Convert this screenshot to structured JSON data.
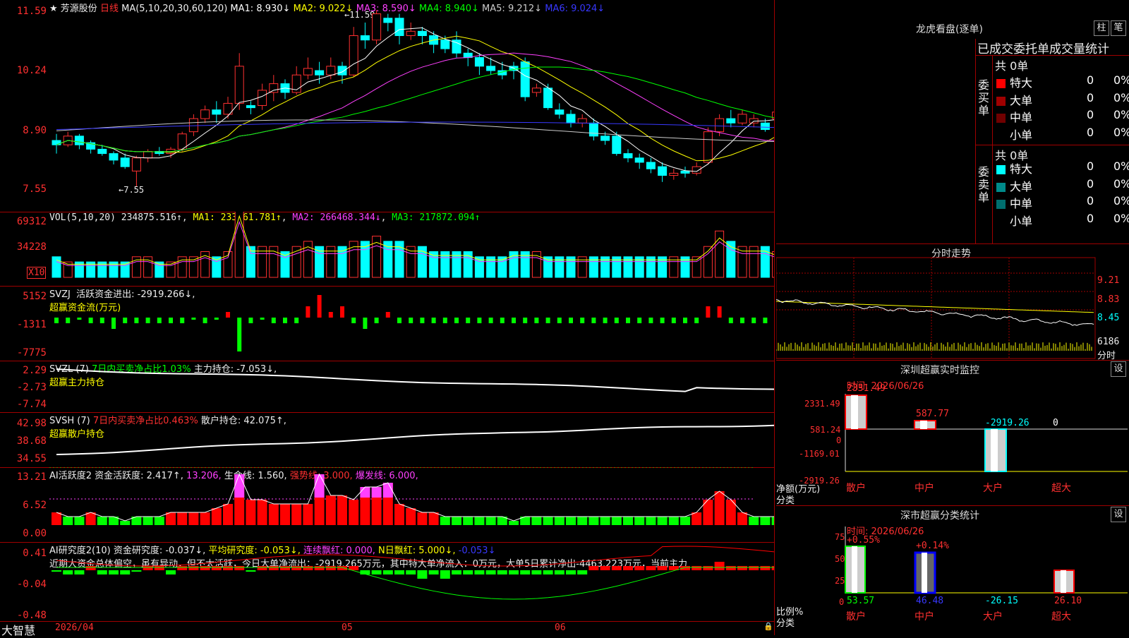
{
  "main": {
    "stock_name": "芳源股份",
    "period": "日线",
    "ma_params": "MA(5,10,20,30,60,120)",
    "ma": [
      {
        "label": "MA1: 8.930↓",
        "color": "#ffffff"
      },
      {
        "label": "MA2: 9.022↓",
        "color": "#ffff00"
      },
      {
        "label": "MA3: 8.590↓",
        "color": "#ff40ff"
      },
      {
        "label": "MA4: 8.940↓",
        "color": "#00ff00"
      },
      {
        "label": "MA5: 9.212↓",
        "color": "#cccccc"
      },
      {
        "label": "MA6: 9.024↓",
        "color": "#3838ff"
      }
    ],
    "y_ticks": [
      "11.59",
      "10.24",
      "8.90",
      "7.55"
    ],
    "high_label": "11.59",
    "low_label": "7.55"
  },
  "vol": {
    "title": "VOL(5,10,20)",
    "value": "234875.516↑",
    "ma1": "MA1: 233261.781↑",
    "ma2": "MA2: 266468.344↓",
    "ma3": "MA3: 217872.094↑",
    "y_ticks": [
      "69312",
      "34228"
    ],
    "unit": "X10"
  },
  "svzj": {
    "title": "SVZJ",
    "label": "活跃资金进出: -2919.266↓,",
    "subtitle": "超赢资金流(万元)",
    "y_ticks": [
      "5152",
      "-1311",
      "-7775"
    ]
  },
  "svzl": {
    "title": "SVZL (7)",
    "ratio": "7日内买卖净占比1.03%",
    "label": "主力持仓: -7.053↓,",
    "subtitle": "超赢主力持仓",
    "y_ticks": [
      "2.29",
      "-2.73",
      "-7.74"
    ]
  },
  "svsh": {
    "title": "SVSH (7)",
    "ratio": "7日内买卖净占比0.463%",
    "label": "散户持仓: 42.075↑,",
    "subtitle": "超赢散户持仓",
    "y_ticks": [
      "42.98",
      "38.68",
      "34.55"
    ]
  },
  "ai1": {
    "title": "AI活跃度2",
    "label1": "资金活跃度: 2.417↑,",
    "label2": "13.206,",
    "label3": "生命线: 1.560,",
    "label4": "强势线: 3.000,",
    "label5": "爆发线: 6.000,",
    "y_ticks": [
      "13.21",
      "6.52",
      "0.00"
    ]
  },
  "ai2": {
    "title": "AI研究度2(10)",
    "label1": "资金研究度: -0.037↓,",
    "label2": "平均研究度: -0.053↓,",
    "label3": "连续飘红: 0.000,",
    "label4": "N日飘红: 5.000↓,",
    "label5": "-0.053↓",
    "comment": "近期大资金总体偏空，虽有异动，但不太活跃，今日大单净流出：-2919.265万元，其中特大单净流入：0万元，大单5日累计净出-4463.223万元，当前主力",
    "y_ticks": [
      "0.41",
      "-0.04",
      "-0.48"
    ]
  },
  "bottom": {
    "logo": "大智慧",
    "date_label": "2026/04",
    "month_05": "05",
    "month_06": "06"
  },
  "right": {
    "dragon_title": "龙虎看盘(逐单)",
    "btn_zhu": "柱",
    "btn_bi": "笔",
    "stat_header": "已成交委托单成交量统计",
    "buy_label": "委买单",
    "sell_label": "委卖单",
    "buy_total": "共 0单",
    "sell_total": "共 0单",
    "buy_rows": [
      {
        "name": "特大",
        "count": "0",
        "pct": "0%",
        "color": "#ff0000"
      },
      {
        "name": "大单",
        "count": "0",
        "pct": "0%",
        "color": "#a00000"
      },
      {
        "name": "中单",
        "count": "0",
        "pct": "0%",
        "color": "#700000"
      },
      {
        "name": "小单",
        "count": "0",
        "pct": "0%",
        "color": "#000000"
      }
    ],
    "sell_rows": [
      {
        "name": "特大",
        "count": "0",
        "pct": "0%",
        "color": "#00ffff"
      },
      {
        "name": "大单",
        "count": "0",
        "pct": "0%",
        "color": "#008b8b"
      },
      {
        "name": "中单",
        "count": "0",
        "pct": "0%",
        "color": "#006e6e"
      },
      {
        "name": "小单",
        "count": "0",
        "pct": "0%",
        "color": "#000000"
      }
    ],
    "intraday_title": "分时走势",
    "intraday_ticks": [
      "9.21",
      "8.83",
      "8.45",
      "6186"
    ],
    "intraday_unit": "分时",
    "sz_monitor_title": "深圳超赢实时监控",
    "set_btn": "设",
    "sz_time": "时间: 2026/06/26",
    "sz_ticks": [
      "2331.49",
      "581.24",
      "0",
      "-1169.01",
      "-2919.26"
    ],
    "sz_values": [
      "2331.49",
      "587.77",
      "-2919.26",
      "0"
    ],
    "sz_ylabel": "净额(万元)",
    "sz_xlabel": "分类",
    "cats": [
      "散户",
      "中户",
      "大户",
      "超大"
    ],
    "sc_title": "深市超赢分类统计",
    "sc_time": "时间: 2026/06/26",
    "sc_ticks": [
      "75",
      "50",
      "25",
      "0"
    ],
    "sc_top": [
      "+0.55%",
      "+0.14%"
    ],
    "sc_values": [
      "53.57",
      "46.48",
      "-26.15",
      "26.10"
    ],
    "sc_ylabel": "比例%",
    "sc_xlabel": "分类"
  },
  "chart_data": {
    "type": "candlestick",
    "candles": [
      [
        8.6,
        8.5,
        8.75,
        8.3
      ],
      [
        8.5,
        8.7,
        8.8,
        8.45
      ],
      [
        8.7,
        8.5,
        8.75,
        8.4
      ],
      [
        8.55,
        8.4,
        8.6,
        8.3
      ],
      [
        8.4,
        8.3,
        8.5,
        8.25
      ],
      [
        8.3,
        8.15,
        8.35,
        8.05
      ],
      [
        8.2,
        8.0,
        8.3,
        7.95
      ],
      [
        7.9,
        8.2,
        8.25,
        7.55
      ],
      [
        8.2,
        8.35,
        8.4,
        8.1
      ],
      [
        8.35,
        8.3,
        8.45,
        8.25
      ],
      [
        8.3,
        8.4,
        8.45,
        8.2
      ],
      [
        8.4,
        8.75,
        8.8,
        8.35
      ],
      [
        8.8,
        9.1,
        9.2,
        8.7
      ],
      [
        9.1,
        9.3,
        9.4,
        9.0
      ],
      [
        9.3,
        9.2,
        9.5,
        9.0
      ],
      [
        9.2,
        9.45,
        9.6,
        9.1
      ],
      [
        9.45,
        10.3,
        10.6,
        9.3
      ],
      [
        9.4,
        9.35,
        9.5,
        9.2
      ],
      [
        9.4,
        9.75,
        9.9,
        9.3
      ],
      [
        9.7,
        9.9,
        10.1,
        9.5
      ],
      [
        9.9,
        9.7,
        10.0,
        9.55
      ],
      [
        9.7,
        10.1,
        10.3,
        9.65
      ],
      [
        10.1,
        10.25,
        10.5,
        10.0
      ],
      [
        10.2,
        10.1,
        10.4,
        9.9
      ],
      [
        10.1,
        10.3,
        10.5,
        10.0
      ],
      [
        10.3,
        10.1,
        10.4,
        9.9
      ],
      [
        10.1,
        11.0,
        11.2,
        10.05
      ],
      [
        11.0,
        10.9,
        11.3,
        10.7
      ],
      [
        10.9,
        11.5,
        11.59,
        10.8
      ],
      [
        11.4,
        11.3,
        11.5,
        11.1
      ],
      [
        11.4,
        11.0,
        11.5,
        10.8
      ],
      [
        11.0,
        11.1,
        11.3,
        10.9
      ],
      [
        11.1,
        11.0,
        11.2,
        10.8
      ],
      [
        11.0,
        10.8,
        11.1,
        10.6
      ],
      [
        10.9,
        10.7,
        11.0,
        10.6
      ],
      [
        10.9,
        10.6,
        11.1,
        10.5
      ],
      [
        10.6,
        10.5,
        10.7,
        10.3
      ],
      [
        10.5,
        10.3,
        10.6,
        10.1
      ],
      [
        10.3,
        10.2,
        10.5,
        10.1
      ],
      [
        10.2,
        10.1,
        10.4,
        10.0
      ],
      [
        10.3,
        10.2,
        10.4,
        10.0
      ],
      [
        10.4,
        9.6,
        10.5,
        9.5
      ],
      [
        9.7,
        9.8,
        9.9,
        9.6
      ],
      [
        9.8,
        9.35,
        9.9,
        9.3
      ],
      [
        9.3,
        9.2,
        9.45,
        9.1
      ],
      [
        9.2,
        9.0,
        9.3,
        8.9
      ],
      [
        9.0,
        9.1,
        9.2,
        8.9
      ],
      [
        9.0,
        8.7,
        9.1,
        8.6
      ],
      [
        8.7,
        8.6,
        8.8,
        8.5
      ],
      [
        8.7,
        8.3,
        8.8,
        8.25
      ],
      [
        8.3,
        8.2,
        8.4,
        8.1
      ],
      [
        8.2,
        8.1,
        8.3,
        7.95
      ],
      [
        8.1,
        7.95,
        8.2,
        7.85
      ],
      [
        8.0,
        7.8,
        8.1,
        7.65
      ],
      [
        7.8,
        7.85,
        7.95,
        7.7
      ],
      [
        7.9,
        7.85,
        8.0,
        7.75
      ],
      [
        7.85,
        8.0,
        8.1,
        7.8
      ],
      [
        8.1,
        8.8,
        8.9,
        8.05
      ],
      [
        8.8,
        9.1,
        9.2,
        8.7
      ],
      [
        9.1,
        9.0,
        9.3,
        8.9
      ],
      [
        9.0,
        9.2,
        9.3,
        8.95
      ],
      [
        9.0,
        9.1,
        9.2,
        8.9
      ],
      [
        9.0,
        8.85,
        9.1,
        8.8
      ],
      [
        9.1,
        9.25,
        9.35,
        9.0
      ],
      [
        9.2,
        9.1,
        9.3,
        9.0
      ],
      [
        9.15,
        9.0,
        9.3,
        8.9
      ],
      [
        9.1,
        8.75,
        9.2,
        8.7
      ],
      [
        8.8,
        8.35,
        8.9,
        8.3
      ]
    ]
  }
}
